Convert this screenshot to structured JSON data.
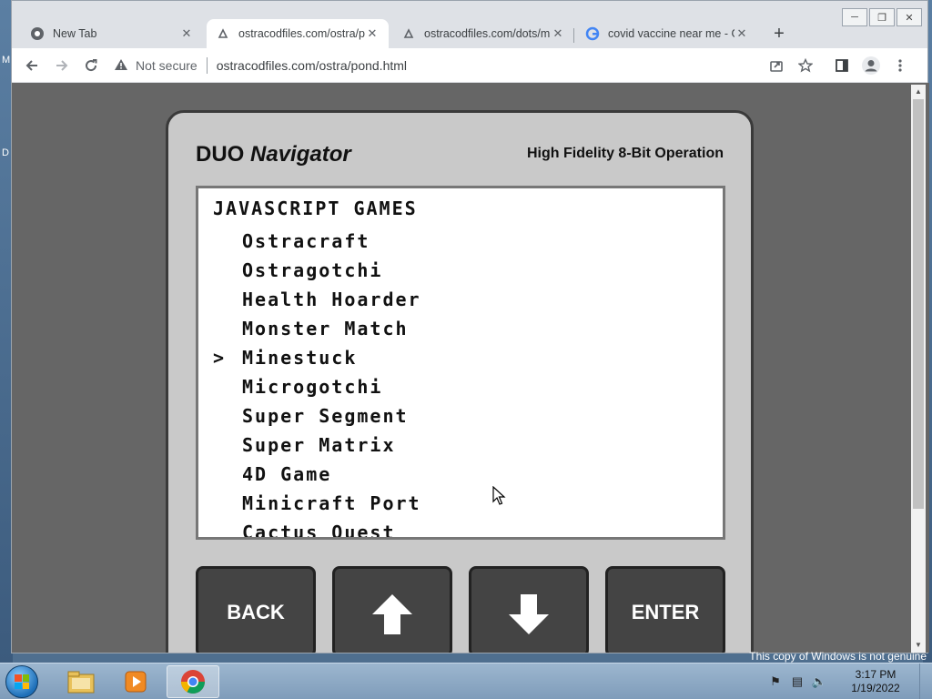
{
  "desktop": {
    "left_labels": [
      "M",
      "D"
    ],
    "watermark": "This copy of Windows is not genuine"
  },
  "window": {
    "controls": [
      "─",
      "❐",
      "✕"
    ]
  },
  "tabs": [
    {
      "title": "New Tab",
      "icon": "chrome-icon",
      "active": false
    },
    {
      "title": "ostracodfiles.com/ostra/p",
      "icon": "page-icon",
      "active": true
    },
    {
      "title": "ostracodfiles.com/dots/m",
      "icon": "page-icon",
      "active": false
    },
    {
      "title": "covid vaccine near me - G",
      "icon": "google-icon",
      "active": false
    }
  ],
  "toolbar": {
    "security_label": "Not secure",
    "url": "ostracodfiles.com/ostra/pond.html"
  },
  "device": {
    "brand": "DUO",
    "model": "Navigator",
    "tagline": "High Fidelity 8-Bit Operation",
    "screen_heading": "JAVASCRIPT GAMES",
    "cursor": ">",
    "menu": [
      {
        "label": "Ostracraft",
        "selected": false
      },
      {
        "label": "Ostragotchi",
        "selected": false
      },
      {
        "label": "Health Hoarder",
        "selected": false
      },
      {
        "label": "Monster Match",
        "selected": false
      },
      {
        "label": "Minestuck",
        "selected": true
      },
      {
        "label": "Microgotchi",
        "selected": false
      },
      {
        "label": "Super Segment",
        "selected": false
      },
      {
        "label": "Super Matrix",
        "selected": false
      },
      {
        "label": "4D Game",
        "selected": false
      },
      {
        "label": "Minicraft Port",
        "selected": false
      },
      {
        "label": "Cactus Quest",
        "selected": false
      }
    ],
    "buttons": {
      "back": "BACK",
      "enter": "ENTER"
    }
  },
  "taskbar": {
    "time": "3:17 PM",
    "date": "1/19/2022"
  }
}
